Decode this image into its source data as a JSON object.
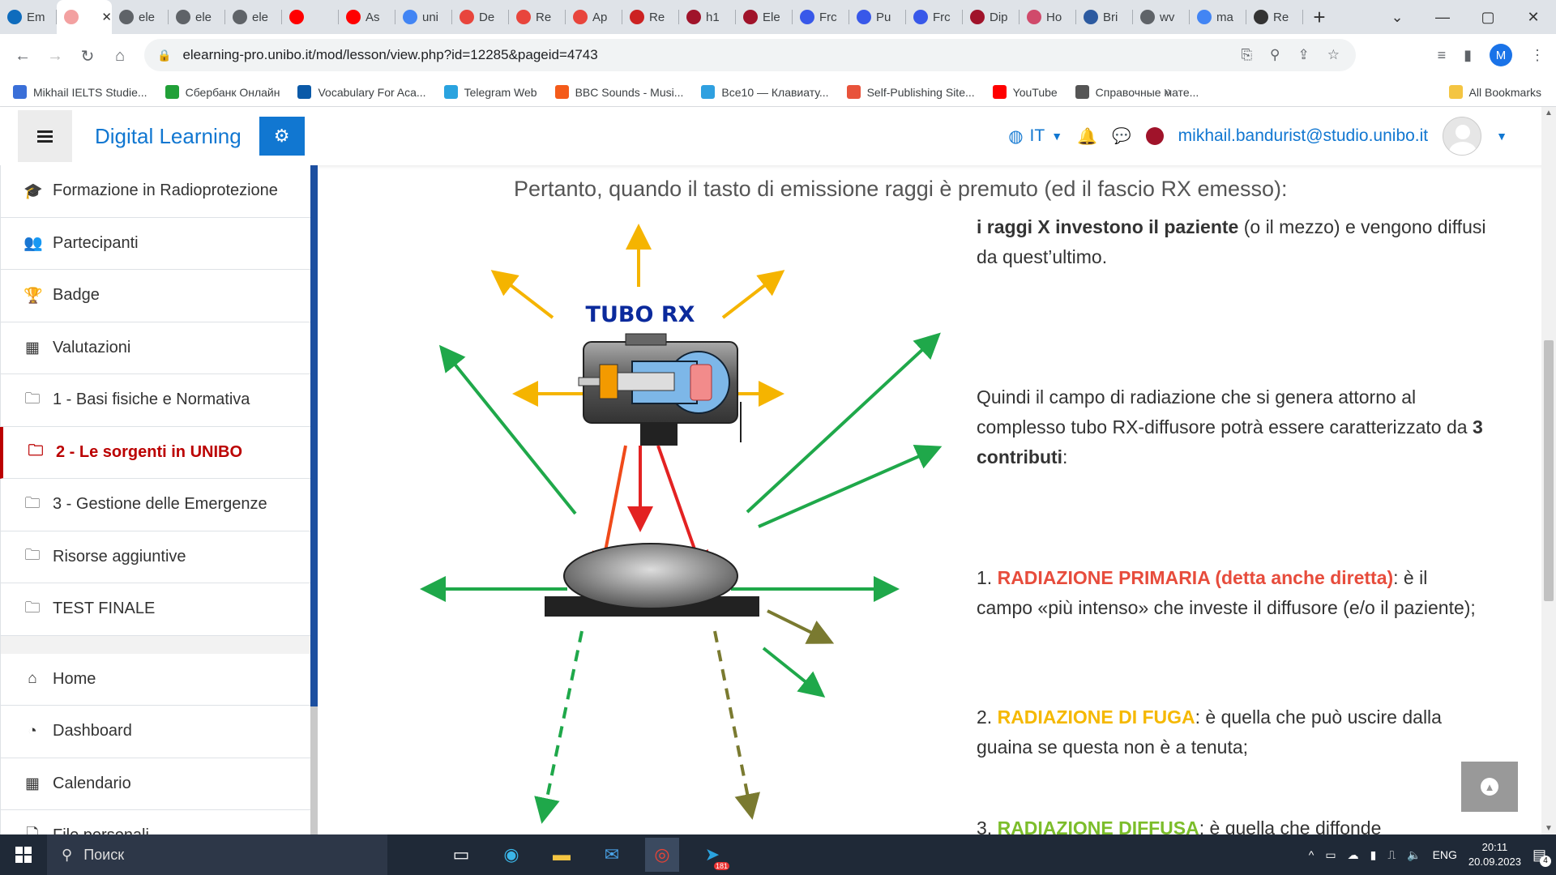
{
  "browser": {
    "tabs": [
      {
        "label": "Em",
        "color": "#0f6cbd"
      },
      {
        "label": "",
        "color": "#f3a1a1",
        "active": true
      },
      {
        "label": "ele",
        "color": "#5f6368"
      },
      {
        "label": "ele",
        "color": "#5f6368"
      },
      {
        "label": "ele",
        "color": "#5f6368"
      },
      {
        "label": "",
        "color": "#ff0000"
      },
      {
        "label": "As",
        "color": "#ff0000"
      },
      {
        "label": "uni",
        "color": "#4285f4"
      },
      {
        "label": "De",
        "color": "#e8453c"
      },
      {
        "label": "Re",
        "color": "#e8453c"
      },
      {
        "label": "Ap",
        "color": "#e8453c"
      },
      {
        "label": "Re",
        "color": "#cc2222"
      },
      {
        "label": "h1",
        "color": "#a0132a"
      },
      {
        "label": "Ele",
        "color": "#a0132a"
      },
      {
        "label": "Frc",
        "color": "#3858e9"
      },
      {
        "label": "Pu",
        "color": "#3858e9"
      },
      {
        "label": "Frc",
        "color": "#3858e9"
      },
      {
        "label": "Dip",
        "color": "#a0132a"
      },
      {
        "label": "Ho",
        "color": "#d04a6b"
      },
      {
        "label": "Bri",
        "color": "#2c5aa0"
      },
      {
        "label": "wv",
        "color": "#5f6368"
      },
      {
        "label": "ma",
        "color": "#4285f4"
      },
      {
        "label": "Re",
        "color": "#333333"
      }
    ],
    "url": "elearning-pro.unibo.it/mod/lesson/view.php?id=12285&pageid=4743",
    "profile_initial": "M",
    "bookmarks": [
      {
        "label": "Mikhail IELTS Studie...",
        "color": "#3a6fd8"
      },
      {
        "label": "Сбербанк Онлайн",
        "color": "#21a038"
      },
      {
        "label": "Vocabulary For Aca...",
        "color": "#0b5aa8"
      },
      {
        "label": "Telegram Web",
        "color": "#2aa3df"
      },
      {
        "label": "BBC Sounds - Musi...",
        "color": "#f45b1a"
      },
      {
        "label": "Все10 — Клавиату...",
        "color": "#2fa0e0"
      },
      {
        "label": "Self-Publishing Site...",
        "color": "#e8533b"
      },
      {
        "label": "YouTube",
        "color": "#ff0000"
      },
      {
        "label": "Справочные мате...",
        "color": "#555555"
      }
    ],
    "more_bookmarks": "»",
    "all_bookmarks": "All Bookmarks"
  },
  "site": {
    "brand": "Digital Learning",
    "lang": "IT",
    "user_email": "mikhail.bandurist@studio.unibo.it"
  },
  "sidebar": {
    "items": [
      {
        "label": "Formazione in Radioprotezione",
        "icon": "graduation-cap-icon"
      },
      {
        "label": "Partecipanti",
        "icon": "users-icon"
      },
      {
        "label": "Badge",
        "icon": "trophy-icon"
      },
      {
        "label": "Valutazioni",
        "icon": "table-icon"
      },
      {
        "label": "1 - Basi fisiche e Normativa",
        "icon": "folder-icon"
      },
      {
        "label": "2 - Le sorgenti in UNIBO",
        "icon": "folder-icon",
        "active": true
      },
      {
        "label": "3 - Gestione delle Emergenze",
        "icon": "folder-icon"
      },
      {
        "label": "Risorse aggiuntive",
        "icon": "folder-icon"
      },
      {
        "label": "TEST FINALE",
        "icon": "folder-icon"
      }
    ],
    "nav": [
      {
        "label": "Home",
        "icon": "home-icon"
      },
      {
        "label": "Dashboard",
        "icon": "dashboard-icon"
      },
      {
        "label": "Calendario",
        "icon": "calendar-icon"
      },
      {
        "label": "File personali",
        "icon": "file-icon"
      }
    ]
  },
  "lesson": {
    "heading": "Pertanto, quando il tasto di emissione raggi è premuto (ed il fascio RX emesso):",
    "p1_bold": "i raggi X investono il paziente",
    "p1_rest": " (o il mezzo) e vengono diffusi da quest’ultimo.",
    "p2_a": "Quindi il campo di radiazione che si genera attorno al complesso tubo RX-diffusore potrà essere caratterizzato da ",
    "p2_bold": "3 contributi",
    "p2_end": ":",
    "item1_num": "1. ",
    "item1_title": "RADIAZIONE PRIMARIA (detta anche diretta)",
    "item1_text": ": è il campo «più intenso» che investe il diffusore (e/o il paziente);",
    "item2_num": "2. ",
    "item2_title": "RADIAZIONE DI FUGA",
    "item2_text": ": è quella che può uscire dalla guaina se questa non è a tenuta;",
    "item3_num": "3. ",
    "item3_title": "RADIAZIONE DIFFUSA",
    "item3_text": ": è quella che diffonde",
    "tube_label": "TUBO RX"
  },
  "taskbar": {
    "search": "Поиск",
    "lang": "ENG",
    "time": "20:11",
    "date": "20.09.2023",
    "telegram_badge": "181",
    "notif_count": "4"
  }
}
